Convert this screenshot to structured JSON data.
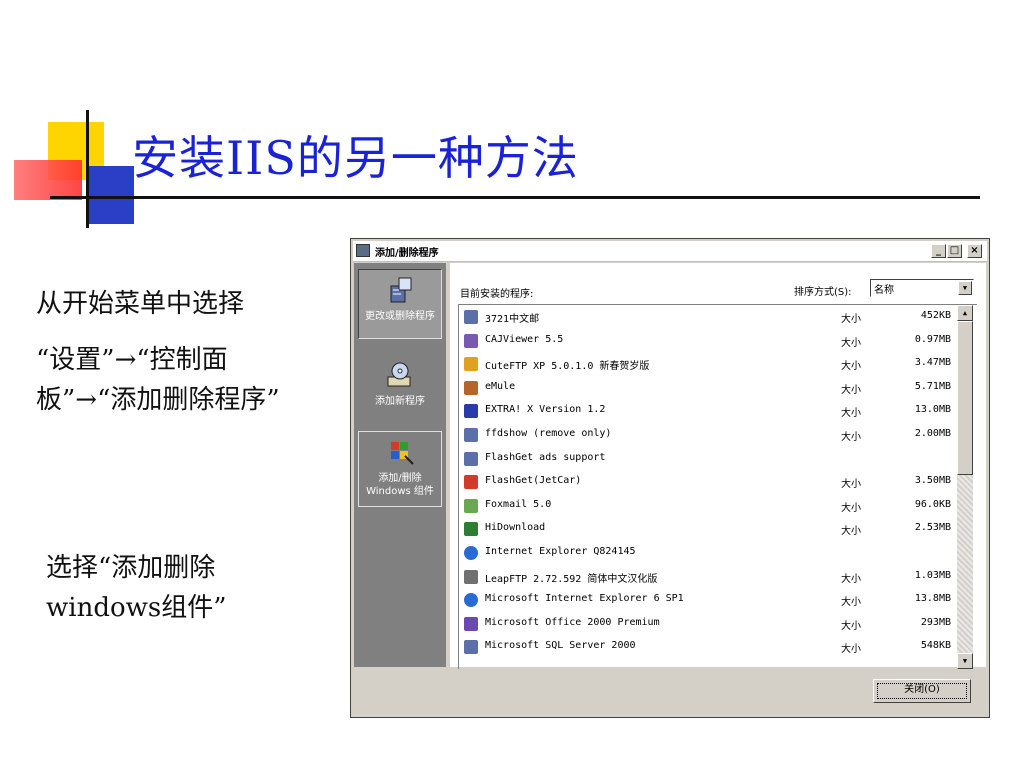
{
  "slide": {
    "title": "安装IIS的另一种方法",
    "text1": "从开始菜单中选择",
    "text2": "“设置”→“控制面板”→“添加删除程序”",
    "text3": "选择“添加删除windows组件”"
  },
  "window": {
    "title": "添加/删除程序",
    "min_glyph": "_",
    "max_glyph": "□",
    "close_glyph": "×",
    "sidebar": [
      {
        "label": "更改或删除程序",
        "icon": "cd-install-icon"
      },
      {
        "label": "添加新程序",
        "icon": "add-cd-icon"
      },
      {
        "label": "添加/删除 Windows 组件",
        "icon": "windows-components-icon"
      }
    ],
    "installed_label": "目前安装的程序:",
    "sort_label": "排序方式(S):",
    "sort_value": "名称",
    "size_label": "大小",
    "programs": [
      {
        "name": "3721中文邮",
        "size": "452KB",
        "color": "#5b6fa8"
      },
      {
        "name": "CAJViewer 5.5",
        "size": "0.97MB",
        "color": "#7a5ab0"
      },
      {
        "name": "CuteFTP XP 5.0.1.0 新春贺岁版",
        "size": "3.47MB",
        "color": "#e0a020"
      },
      {
        "name": "eMule",
        "size": "5.71MB",
        "color": "#b5652a"
      },
      {
        "name": "EXTRA! X Version 1.2",
        "size": "13.0MB",
        "color": "#2a3aa8"
      },
      {
        "name": "ffdshow (remove only)",
        "size": "2.00MB",
        "color": "#5b6fa8"
      },
      {
        "name": "FlashGet ads support",
        "size": "",
        "color": "#5b6fa8"
      },
      {
        "name": "FlashGet(JetCar)",
        "size": "3.50MB",
        "color": "#d23a2a"
      },
      {
        "name": "Foxmail 5.0",
        "size": "96.0KB",
        "color": "#6aa84f"
      },
      {
        "name": "HiDownload",
        "size": "2.53MB",
        "color": "#2e7d32"
      },
      {
        "name": "Internet Explorer Q824145",
        "size": "",
        "color": "#2a6ad4"
      },
      {
        "name": "LeapFTP 2.72.592 简体中文汉化版",
        "size": "1.03MB",
        "color": "#707070"
      },
      {
        "name": "Microsoft Internet Explorer 6 SP1",
        "size": "13.8MB",
        "color": "#2a6ad4"
      },
      {
        "name": "Microsoft Office 2000 Premium",
        "size": "293MB",
        "color": "#6a4ab0"
      },
      {
        "name": "Microsoft SQL Server 2000",
        "size": "548KB",
        "color": "#5b6fa8"
      }
    ],
    "close_button": "关闭(O)"
  }
}
